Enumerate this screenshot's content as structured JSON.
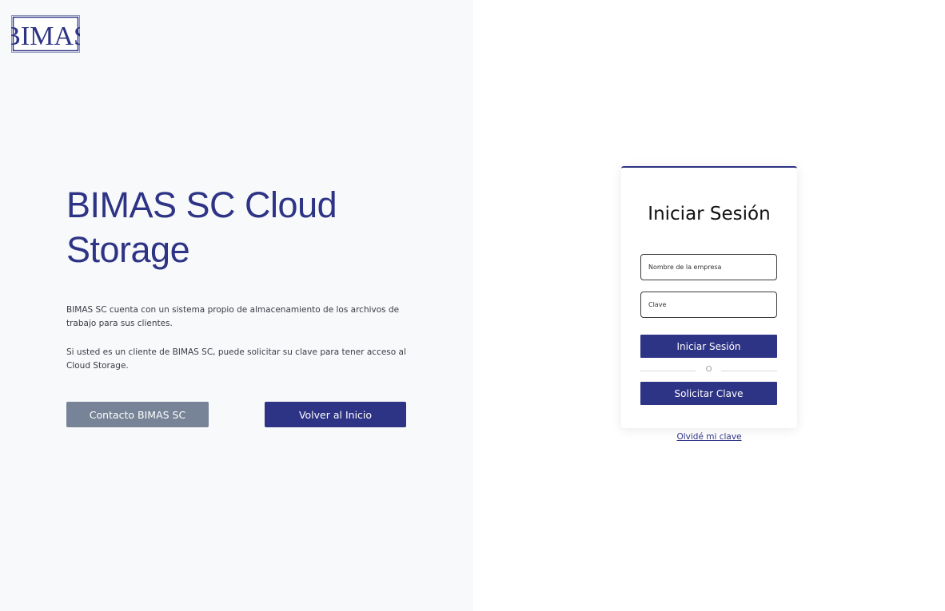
{
  "brand": {
    "logo_text": "BIMAS",
    "logo_icon": "bimas-logo",
    "primary_color": "#2e3485",
    "secondary_button_color": "#778397",
    "left_panel_bg": "#f8f9fb"
  },
  "hero": {
    "title": "BIMAS SC Cloud Storage",
    "paragraph1": "BIMAS SC cuenta con un sistema propio de almacenamiento de los archivos de trabajo para sus clientes.",
    "paragraph2": "Si usted es un cliente de BIMAS SC, puede solicitar su clave para tener acceso al Cloud Storage.",
    "contact_button": "Contacto BIMAS SC",
    "home_button": "Volver al Inicio"
  },
  "login": {
    "title": "Iniciar Sesión",
    "company_placeholder": "Nombre de la empresa",
    "company_value": "",
    "key_placeholder": "Clave",
    "key_value": "",
    "submit_button": "Iniciar Sesión",
    "divider_text": "O",
    "request_button": "Solicitar Clave",
    "forgot_link": "Olvidé mi clave"
  }
}
